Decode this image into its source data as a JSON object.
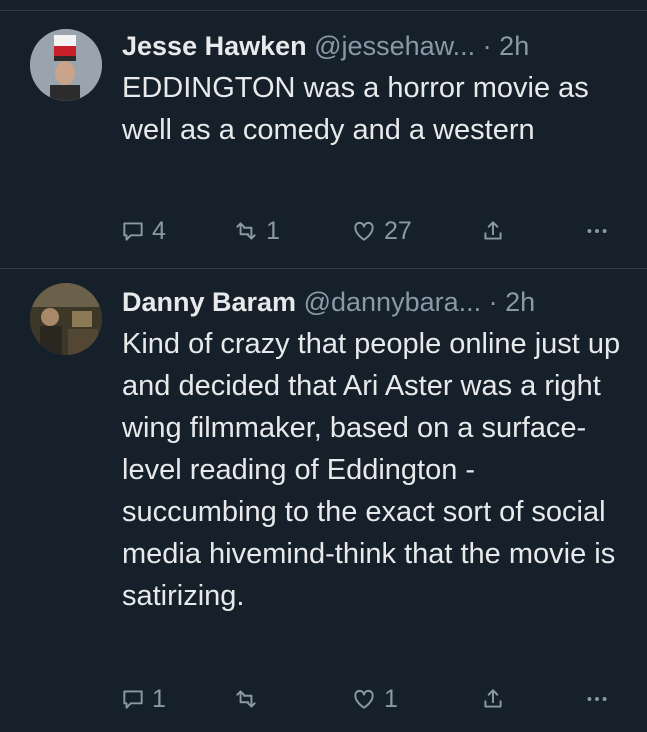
{
  "tweets": [
    {
      "name": "Jesse Hawken",
      "handle": "@jessehaw...",
      "separator": "·",
      "time": "2h",
      "text": "EDDINGTON was a horror movie as well as a comedy and a western",
      "reply_count": "4",
      "retweet_count": "1",
      "like_count": "27"
    },
    {
      "name": "Danny Baram",
      "handle": "@dannybara...",
      "separator": "·",
      "time": "2h",
      "text": "Kind of crazy that people online just up and decided that Ari Aster was a right wing filmmaker, based on a surface-level reading of Eddington - succumbing to the exact sort of social media hivemind-think that the movie is satirizing.",
      "reply_count": "1",
      "retweet_count": "",
      "like_count": "1"
    }
  ],
  "colors": {
    "background": "#15202b",
    "text_primary": "#e7e9ea",
    "text_secondary": "#8b98a5",
    "divider": "#2f3a44"
  },
  "icons": [
    "reply-icon",
    "retweet-icon",
    "like-icon",
    "share-icon",
    "more-icon"
  ]
}
